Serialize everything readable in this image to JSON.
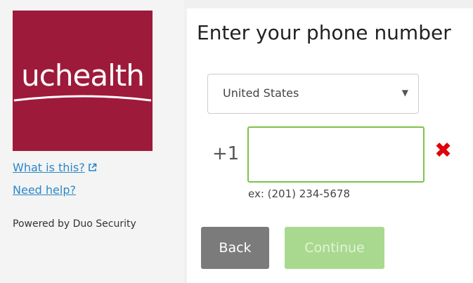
{
  "brand": {
    "logo_text": "uchealth",
    "logo_color": "#9e1a3a"
  },
  "sidebar": {
    "what_is_this": "What is this?",
    "need_help": "Need help?",
    "powered_by": "Powered by Duo Security"
  },
  "main": {
    "title": "Enter your phone number",
    "country": {
      "selected": "United States",
      "caret_icon": "chevron-down-icon"
    },
    "phone": {
      "prefix": "+1",
      "value": "",
      "placeholder": "",
      "error_icon": "x-mark-icon",
      "example": "ex: (201) 234-5678"
    },
    "buttons": {
      "back": "Back",
      "continue": "Continue"
    }
  },
  "colors": {
    "link": "#2a87c8",
    "input_border_valid": "#7dc24a",
    "error": "#e0000b",
    "back_button": "#7b7b7b",
    "continue_disabled": "#a9d98f"
  }
}
